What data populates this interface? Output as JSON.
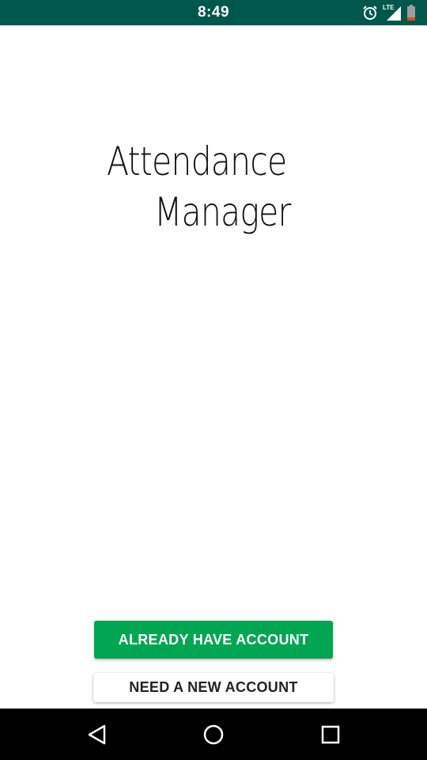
{
  "status_bar": {
    "time": "8:49",
    "icons": [
      "alarm-icon",
      "lte-signal-icon",
      "battery-icon"
    ],
    "network_label": "LTE",
    "background_color": "#00574b"
  },
  "app": {
    "title_line1": "Attendance",
    "title_line2": "Manager"
  },
  "buttons": {
    "primary_label": "ALREADY HAVE ACCOUNT",
    "secondary_label": "NEED A NEW ACCOUNT",
    "primary_color": "#00a651"
  },
  "nav_bar": {
    "icons": [
      "back-icon",
      "home-icon",
      "recents-icon"
    ]
  }
}
